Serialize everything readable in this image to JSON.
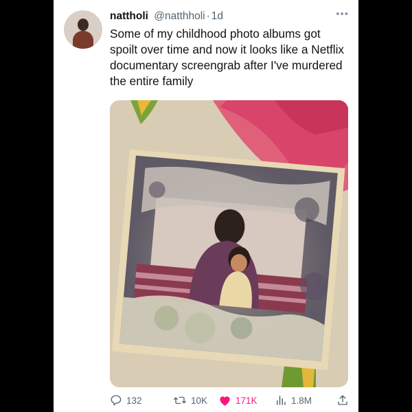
{
  "tweet": {
    "author_name": "nattholi",
    "handle": "@natthholi",
    "separator": "·",
    "time": "1d",
    "text": "Some of my childhood photo albums got spoilt over time and now it looks like a Netflix documentary screengrab after I've murdered the entire family"
  },
  "stats": {
    "replies": "132",
    "retweets": "10K",
    "likes": "171K",
    "views": "1.8M"
  },
  "icons": {
    "more": "more-icon",
    "reply": "reply-icon",
    "retweet": "retweet-icon",
    "like": "heart-icon",
    "views": "views-icon",
    "share": "share-icon"
  },
  "colors": {
    "like_active": "#f91880",
    "text_primary": "#0f1419",
    "text_secondary": "#536471"
  }
}
